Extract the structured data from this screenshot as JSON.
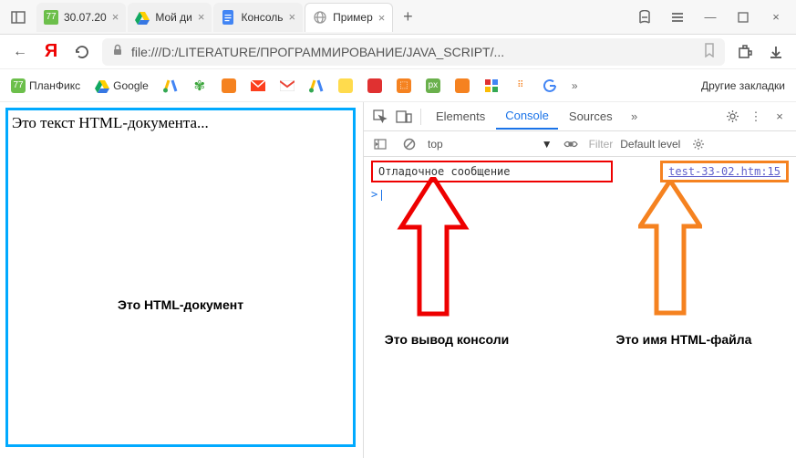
{
  "titlebar": {
    "tabs": [
      {
        "label": "30.07.20",
        "favColor": "#6cbf4b",
        "favTxt": "77"
      },
      {
        "label": "Мой ди",
        "favColor": "#transparent",
        "favTxt": ""
      },
      {
        "label": "Консоль",
        "favColor": "transparent",
        "favTxt": ""
      },
      {
        "label": "Пример",
        "favColor": "transparent",
        "favTxt": ""
      }
    ]
  },
  "addr": {
    "url": "file:///D:/LITERATURE/ПРОГРАММИРОВАНИЕ/JAVA_SCRIPT/..."
  },
  "bookmarks": {
    "items": [
      "ПланФикс",
      "Google"
    ],
    "other": "Другие закладки"
  },
  "doc": {
    "text": "Это текст HTML-документа...",
    "label": "Это HTML-документ"
  },
  "devtools": {
    "tabs": {
      "elements": "Elements",
      "console": "Console",
      "sources": "Sources"
    },
    "context": "top",
    "filter": "Filter",
    "level": "Default level",
    "msg": "Отладочное сообщение",
    "src": "test-33-02.htm:15",
    "prompt": ">"
  },
  "ann": {
    "console": "Это вывод консоли",
    "file": "Это имя HTML-файла"
  }
}
